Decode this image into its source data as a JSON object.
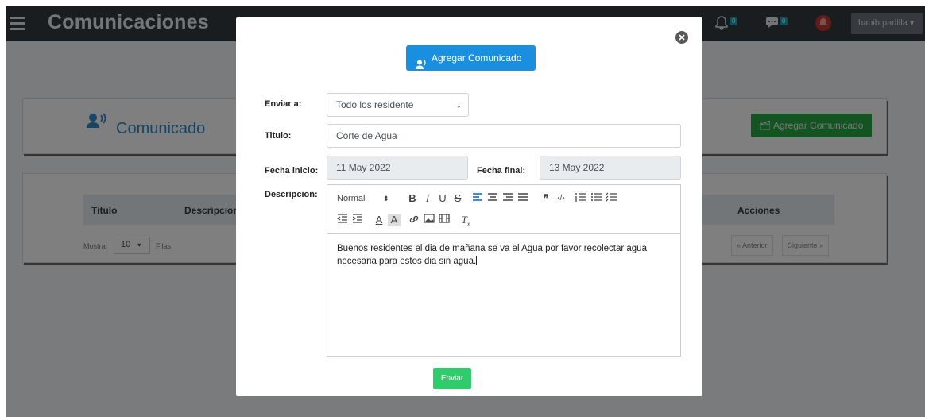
{
  "app": {
    "title": "Comunicaciones",
    "user_name": "habib padilla",
    "notifications_count": "0",
    "messages_count": "0"
  },
  "card": {
    "title": "Comunicado",
    "add_button": "Agregar Comunicado"
  },
  "table": {
    "headers": [
      "Titulo",
      "Descripcion",
      "Acciones"
    ],
    "show_label": "Mostrar",
    "page_size": "10",
    "rows_label": "Filas",
    "prev": "« Anterior",
    "next": "Siguiente »"
  },
  "modal": {
    "add_button": "Agregar Comunicado",
    "send_to_label": "Enviar a:",
    "send_to_value": "Todo los residente",
    "title_label": "Titulo:",
    "title_value": "Corte de Agua",
    "start_label": "Fecha inicio:",
    "start_value": "11 May 2022",
    "end_label": "Fecha final:",
    "end_value": "13 May 2022",
    "desc_label": "Descripcion:",
    "format_value": "Normal",
    "description": "Buenos residentes el dia de mañana se va el Agua por favor recolectar agua necesaria para estos dia sin agua.",
    "send_button": "Enviar"
  },
  "colors": {
    "accent_blue": "#1a8fe0",
    "green": "#28a745",
    "send_green": "#2fcc6b",
    "topbar": "#343a40"
  }
}
